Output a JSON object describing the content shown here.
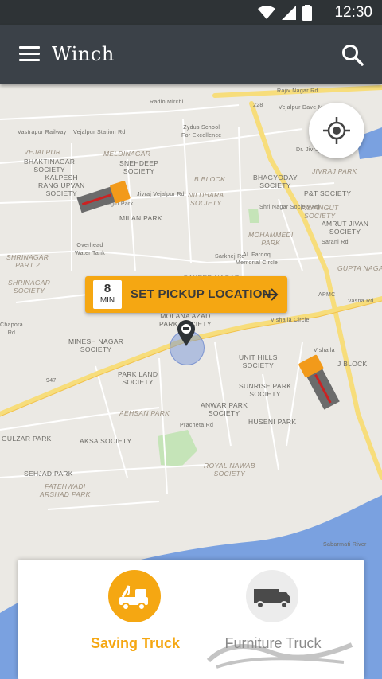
{
  "status_bar": {
    "time": "12:30"
  },
  "app_bar": {
    "title": "Winch"
  },
  "map": {
    "labels": [
      {
        "text": "Rajiv Nagar Rd",
        "cls": "small"
      },
      {
        "text": "Radio Mirchi",
        "cls": "small"
      },
      {
        "text": "Vejalpur Dave Marg",
        "cls": "small"
      },
      {
        "text": "Vastrapur Railway",
        "cls": "small"
      },
      {
        "text": "Vejalpur Station Rd",
        "cls": "small"
      },
      {
        "text": "Zydus School\nFor Excellence",
        "cls": "small"
      },
      {
        "text": "Dr. Jivraj Mehta",
        "cls": "small"
      },
      {
        "text": "VEJALPUR",
        "cls": "italic"
      },
      {
        "text": "MELDINAGAR",
        "cls": "italic"
      },
      {
        "text": "BHAKTINAGAR\nSOCIETY",
        "cls": ""
      },
      {
        "text": "SNEHDEEP\nSOCIETY",
        "cls": ""
      },
      {
        "text": "B BLOCK",
        "cls": "italic"
      },
      {
        "text": "BHAGYODAY\nSOCIETY",
        "cls": ""
      },
      {
        "text": "JIVRAJ PARK",
        "cls": "italic"
      },
      {
        "text": "KALPESH\nRANG UPVAN\nSOCIETY",
        "cls": ""
      },
      {
        "text": "Jivraj Vejalpur Rd",
        "cls": "small"
      },
      {
        "text": "Nilgiri Park",
        "cls": "small"
      },
      {
        "text": "NILDHARA\nSOCIETY",
        "cls": "italic"
      },
      {
        "text": "Shri Nagar Society Rd",
        "cls": "small"
      },
      {
        "text": "P&T SOCIETY",
        "cls": ""
      },
      {
        "text": "PAYANGUT\nSOCIETY",
        "cls": "italic"
      },
      {
        "text": "MILAN PARK",
        "cls": ""
      },
      {
        "text": "AMRUT JIVAN\nSOCIETY",
        "cls": ""
      },
      {
        "text": "Sarani Rd",
        "cls": "small"
      },
      {
        "text": "Overhead\nWater Tank",
        "cls": "small"
      },
      {
        "text": "MOHAMMEDI\nPARK",
        "cls": "italic"
      },
      {
        "text": "SHRINAGAR\nPART 2",
        "cls": "italic"
      },
      {
        "text": "Sarkhej Rd",
        "cls": "small"
      },
      {
        "text": "AL Farooq\nMemorial Circle",
        "cls": "small"
      },
      {
        "text": "GUPTA NAGAR",
        "cls": "italic"
      },
      {
        "text": "SHRINAGAR\nSOCIETY",
        "cls": "italic"
      },
      {
        "text": "SAKEER NAGAR",
        "cls": "italic"
      },
      {
        "text": "APMC",
        "cls": "small"
      },
      {
        "text": "Vasna Rd",
        "cls": "small"
      },
      {
        "text": "MOLANA AZAD\nPARK SOCIETY",
        "cls": ""
      },
      {
        "text": "Vishalla Circle",
        "cls": "small"
      },
      {
        "text": "Chapora\nRd",
        "cls": "small"
      },
      {
        "text": "MINESH NAGAR\nSOCIETY",
        "cls": ""
      },
      {
        "text": "UNIT HILLS\nSOCIETY",
        "cls": ""
      },
      {
        "text": "Vishalla",
        "cls": "small"
      },
      {
        "text": "J BLOCK",
        "cls": ""
      },
      {
        "text": "PARK LAND\nSOCIETY",
        "cls": ""
      },
      {
        "text": "SUNRISE PARK\nSOCIETY",
        "cls": ""
      },
      {
        "text": "AEHSAN PARK",
        "cls": "italic"
      },
      {
        "text": "ANWAR PARK\nSOCIETY",
        "cls": ""
      },
      {
        "text": "Pracheta Rd",
        "cls": "small"
      },
      {
        "text": "HUSENI PARK",
        "cls": ""
      },
      {
        "text": "GULZAR PARK",
        "cls": ""
      },
      {
        "text": "AKSA SOCIETY",
        "cls": ""
      },
      {
        "text": "ROYAL NAWAB\nSOCIETY",
        "cls": "italic"
      },
      {
        "text": "SEHJAD PARK",
        "cls": ""
      },
      {
        "text": "FATEHWADI\nARSHAD PARK",
        "cls": "italic"
      },
      {
        "text": "Sabarmati River",
        "cls": "small"
      },
      {
        "text": "947",
        "cls": "small"
      },
      {
        "text": "228",
        "cls": "small"
      }
    ]
  },
  "pickup": {
    "eta_value": "8",
    "eta_unit": "MIN",
    "label": "SET PICKUP LOCATION"
  },
  "vehicle_options": [
    {
      "label": "Saving Truck",
      "icon": "tow-truck-icon",
      "selected": true
    },
    {
      "label": "Furniture Truck",
      "icon": "box-truck-icon",
      "selected": false
    }
  ],
  "colors": {
    "accent": "#f5a712",
    "app_bar": "#3b4148",
    "status_bar": "#2e3336",
    "water": "#7aa1e0",
    "park": "#c5e4b8"
  }
}
